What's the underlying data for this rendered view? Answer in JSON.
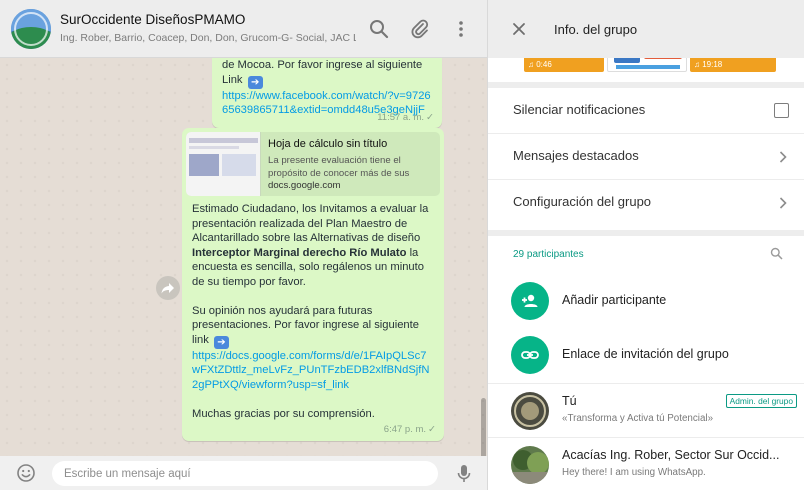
{
  "chat": {
    "title": "SurOccidente DiseñosPMAMO",
    "members": "Ing. Rober, Barrio, Coacep, Don, Don, Grucom-G- Social, JAC L...",
    "icons": {
      "search": "search-icon",
      "attach": "paperclip-icon",
      "menu": "kebab-menu-icon",
      "forward": "forward-icon",
      "emoji": "emoji-icon",
      "mic": "microphone-icon"
    }
  },
  "messages": [
    {
      "lines": [
        "de Mocoa. Por favor ingrese al siguiente",
        "Link"
      ],
      "link": "https://www.facebook.com/watch/?v=972665639865711&extid=omdd48u5e3geNjjF",
      "time": "11:57 a. m."
    },
    {
      "preview": {
        "title": "Hoja de cálculo sin título",
        "description": "La presente evaluación tiene el propósito de conocer más de sus",
        "domain": "docs.google.com"
      },
      "body_pre": "Estimado Ciudadano, los Invitamos a evaluar la presentación realizada del Plan Maestro de Alcantarillado sobre las Alternativas de diseño",
      "body_bold": "Interceptor Marginal derecho Río Mulato",
      "body_post": "la encuesta es sencilla, solo regálenos un minuto de su tiempo por favor.",
      "body2_line1": "Su opinión nos ayudará para futuras presentaciones. Por favor ingrese al siguiente",
      "body2_line2": "link",
      "link": "https://docs.google.com/forms/d/e/1FAIpQLSc7wFXtZDttlz_meLvFz_PUnTFzbEDB2xlfBNdSjfN2gPPtXQ/viewform?usp=sf_link",
      "closing": "Muchas gracias por su comprensión.",
      "time": "6:47 p. m."
    }
  ],
  "composer": {
    "placeholder": "Escribe un mensaje aquí"
  },
  "info": {
    "title": "Info. del grupo",
    "media": [
      {
        "duration": "0:46"
      },
      {
        "duration": ""
      },
      {
        "duration": "19:18"
      }
    ],
    "settings": [
      {
        "label": "Silenciar notificaciones",
        "control": "checkbox",
        "checked": false
      },
      {
        "label": "Mensajes destacados",
        "control": "chevron"
      },
      {
        "label": "Configuración del grupo",
        "control": "chevron"
      }
    ],
    "participants_count": "29 participantes",
    "actions": [
      {
        "label": "Añadir participante",
        "icon": "add-person-icon"
      },
      {
        "label": "Enlace de invitación del grupo",
        "icon": "link-icon"
      }
    ],
    "members": [
      {
        "name": "Tú",
        "status": "«Transforma y Activa tú Potencial»",
        "badge": "Admin. del grupo"
      },
      {
        "name": "Acacías Ing. Rober, Sector Sur Occid...",
        "status": "Hey there! I am using WhatsApp."
      }
    ]
  },
  "colors": {
    "accent": "#06b488",
    "bubble": "#dcf8c6",
    "link": "#039be5",
    "wallpaper": "#e5ddd5",
    "media_orange": "#f0a020"
  }
}
